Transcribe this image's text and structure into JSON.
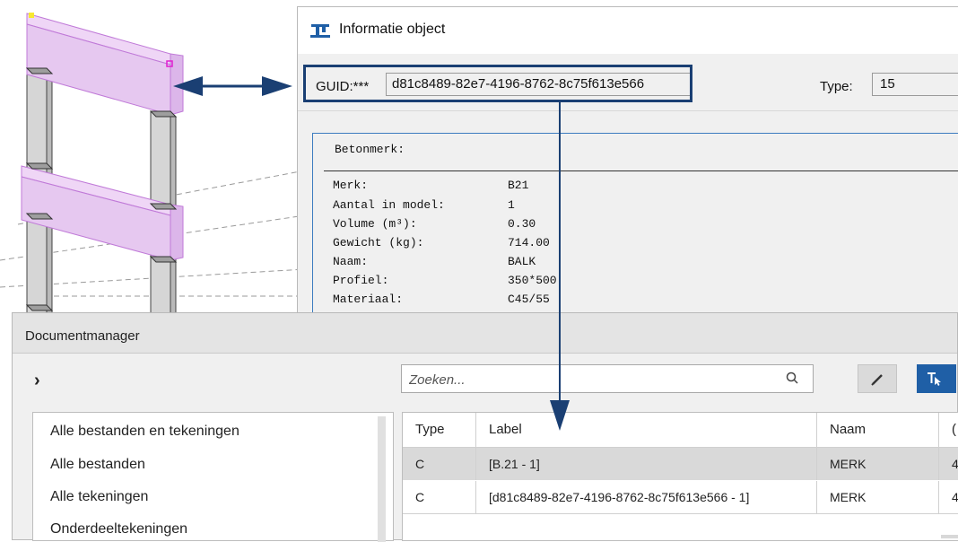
{
  "info_window": {
    "title": "Informatie object",
    "guid_label": "GUID:***",
    "guid_value": "d81c8489-82e7-4196-8762-8c75f613e566",
    "type_label": "Type:",
    "type_value": "15",
    "betonmerk_label": "Betonmerk:",
    "properties": [
      {
        "key": "Merk:",
        "value": "B21"
      },
      {
        "key": "Aantal in model:",
        "value": "1"
      },
      {
        "key": "Volume (m³):",
        "value": "0.30"
      },
      {
        "key": "Gewicht (kg):",
        "value": "714.00"
      },
      {
        "key": "Naam:",
        "value": "BALK"
      },
      {
        "key": "Profiel:",
        "value": "350*500"
      },
      {
        "key": "Materiaal:",
        "value": "C45/55"
      }
    ]
  },
  "document_manager": {
    "title": "Documentmanager",
    "expand_icon": "chevron-right-icon",
    "search_placeholder": "Zoeken...",
    "left_list": [
      "Alle bestanden en tekeningen",
      "Alle bestanden",
      "Alle tekeningen",
      "Onderdeeltekeningen"
    ],
    "table": {
      "headers": [
        "Type",
        "Label",
        "Naam",
        "("
      ],
      "rows": [
        [
          "C",
          "[B.21 - 1]",
          "MERK",
          "4"
        ],
        [
          "C",
          "[d81c8489-82e7-4196-8762-8c75f613e566 - 1]",
          "MERK",
          "4"
        ]
      ]
    }
  },
  "colors": {
    "beam_highlight": "#e6c8f0",
    "annotation": "#1a3f73",
    "accent_button": "#1f5fa6",
    "selected_row": "#d9d9d9"
  }
}
